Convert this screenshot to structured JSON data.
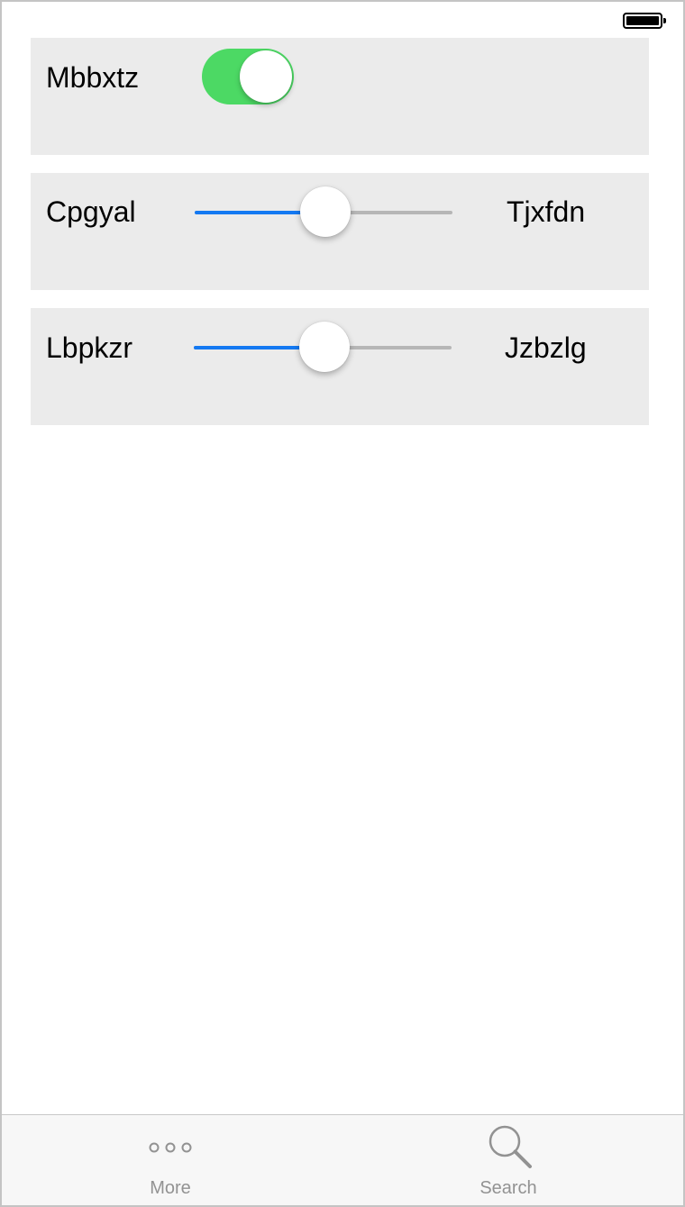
{
  "status_bar": {
    "battery_icon": "battery-full-icon",
    "battery_level": 1.0
  },
  "rows": [
    {
      "label": "Mbbxtz",
      "control": "toggle",
      "on": true,
      "accent": "#4cd964"
    },
    {
      "label": "Cpgyal",
      "control": "slider",
      "value": 0.5,
      "right_label": "Tjxfdn",
      "accent": "#1479f2"
    },
    {
      "label": "Lbpkzr",
      "control": "slider",
      "value": 0.5,
      "right_label": "Jzbzlg",
      "accent": "#1479f2"
    }
  ],
  "tab_bar": {
    "tabs": [
      {
        "label": "More",
        "icon": "more-dots-icon"
      },
      {
        "label": "Search",
        "icon": "search-icon"
      }
    ]
  }
}
